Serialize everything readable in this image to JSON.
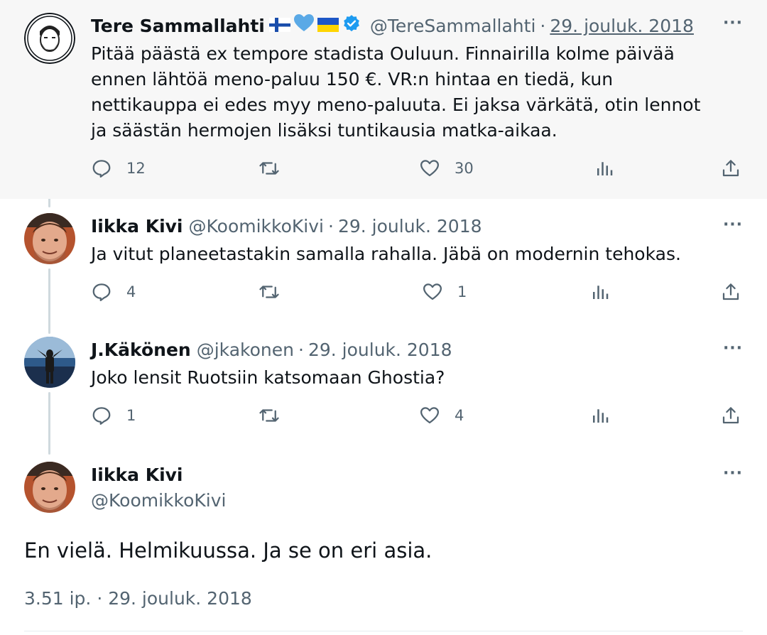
{
  "tweets": [
    {
      "name": "Tere Sammallahti",
      "handle": "@TereSammallahti",
      "separator": "·",
      "date": "29. jouluk. 2018",
      "text": "Pitää päästä ex tempore stadista Ouluun. Finnairilla kolme päivää ennen lähtöä meno-paluu 150 €. VR:n hintaa en tiedä, kun nettikauppa ei edes myy meno-paluuta. Ei jaksa värkätä, otin lennot ja säästän hermojen lisäksi tuntikausia matka-aikaa.",
      "replies": "12",
      "retweets": "",
      "likes": "30",
      "flag_icons": [
        "finland-flag-icon",
        "blue-heart-icon",
        "ukraine-flag-icon",
        "verified-badge-icon"
      ]
    },
    {
      "name": "Iikka Kivi",
      "handle": "@KoomikkoKivi",
      "separator": "·",
      "date": "29. jouluk. 2018",
      "text": "Ja vitut planeetastakin samalla rahalla. Jäbä on modernin tehokas.",
      "replies": "4",
      "retweets": "",
      "likes": "1"
    },
    {
      "name": "J.Käkönen",
      "handle": "@jkakonen",
      "separator": "·",
      "date": "29. jouluk. 2018",
      "text": "Joko lensit Ruotsiin katsomaan Ghostia?",
      "replies": "1",
      "retweets": "",
      "likes": "4"
    }
  ],
  "main_tweet": {
    "name": "Iikka Kivi",
    "handle": "@KoomikkoKivi",
    "text": "En vielä. Helmikuussa. Ja se on eri asia.",
    "timestamp": "3.51 ip. · 29. jouluk. 2018"
  },
  "more_label": "···",
  "colors": {
    "text": "#0f1419",
    "secondary": "#536471",
    "thread_line": "#cfd9de",
    "highlight_bg": "#f7f7f7",
    "verified": "#1d9bf0"
  },
  "icons": {
    "reply": "reply-icon",
    "retweet": "retweet-icon",
    "like": "like-icon",
    "views": "views-icon",
    "share": "share-icon",
    "more": "more-icon"
  }
}
